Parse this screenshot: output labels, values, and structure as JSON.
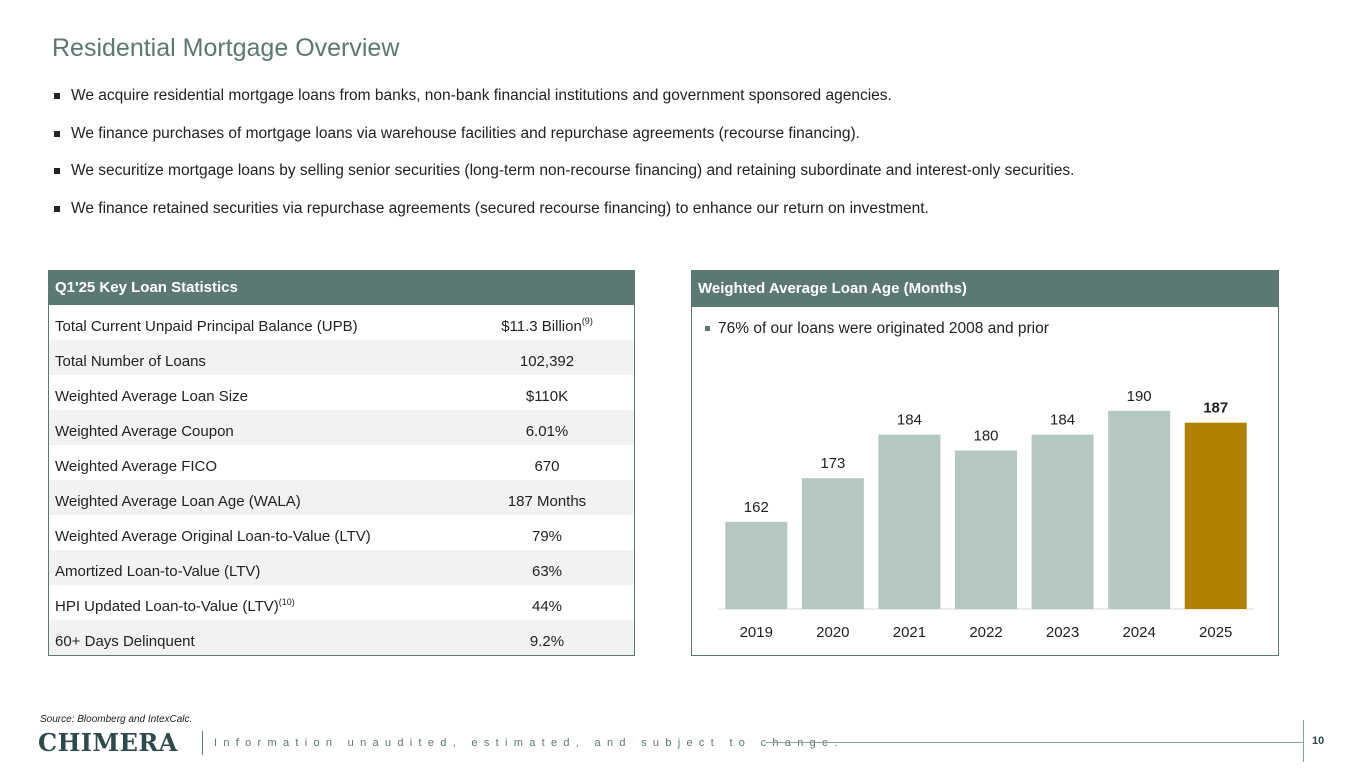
{
  "title": "Residential Mortgage Overview",
  "bullets": [
    "We acquire residential mortgage loans from banks, non-bank financial institutions and government sponsored agencies.",
    "We finance purchases of mortgage loans via warehouse facilities and repurchase agreements (recourse financing).",
    "We securitize mortgage loans by selling senior securities (long-term non-recourse financing) and retaining subordinate and interest-only securities.",
    "We finance retained securities via repurchase agreements (secured recourse financing) to enhance our return on investment."
  ],
  "stats": {
    "header": "Q1'25 Key Loan Statistics",
    "rows": [
      {
        "label": "Total Current Unpaid Principal Balance (UPB)",
        "label_sup": "",
        "value": "$11.3 Billion",
        "value_sup": "(9)"
      },
      {
        "label": "Total Number of Loans",
        "label_sup": "",
        "value": "102,392",
        "value_sup": ""
      },
      {
        "label": "Weighted Average Loan Size",
        "label_sup": "",
        "value": "$110K",
        "value_sup": ""
      },
      {
        "label": "Weighted Average Coupon",
        "label_sup": "",
        "value": "6.01%",
        "value_sup": ""
      },
      {
        "label": "Weighted Average FICO",
        "label_sup": "",
        "value": "670",
        "value_sup": ""
      },
      {
        "label": "Weighted Average Loan Age (WALA)",
        "label_sup": "",
        "value": "187 Months",
        "value_sup": ""
      },
      {
        "label": "Weighted Average Original Loan-to-Value (LTV)",
        "label_sup": "",
        "value": "79%",
        "value_sup": ""
      },
      {
        "label": "Amortized Loan-to-Value (LTV)",
        "label_sup": "",
        "value": "63%",
        "value_sup": ""
      },
      {
        "label": "HPI Updated Loan-to-Value (LTV)",
        "label_sup": "(10)",
        "value": "44%",
        "value_sup": ""
      },
      {
        "label": "60+ Days Delinquent",
        "label_sup": "",
        "value": "9.2%",
        "value_sup": ""
      }
    ]
  },
  "chart_panel": {
    "header": "Weighted Average Loan Age (Months)",
    "note": "76% of our loans were originated 2008 and prior"
  },
  "chart_data": {
    "type": "bar",
    "title": "Weighted Average Loan Age (Months)",
    "categories": [
      "2019",
      "2020",
      "2021",
      "2022",
      "2023",
      "2024",
      "2025"
    ],
    "values": [
      162,
      173,
      184,
      180,
      184,
      190,
      187
    ],
    "highlight_index": 6,
    "colors": {
      "bar": "#b5c7c3",
      "highlight": "#b08000"
    },
    "ylim": [
      140,
      195
    ],
    "grid": false,
    "legend": "none"
  },
  "colors": {
    "accent": "#5b7872",
    "highlight": "#b08000"
  },
  "footer": {
    "source": "Source:  Bloomberg and IntexCalc.",
    "logo": "CHIMERA",
    "disclaimer": "Information unaudited, estimated, and subject to change.",
    "page_number": "10"
  }
}
